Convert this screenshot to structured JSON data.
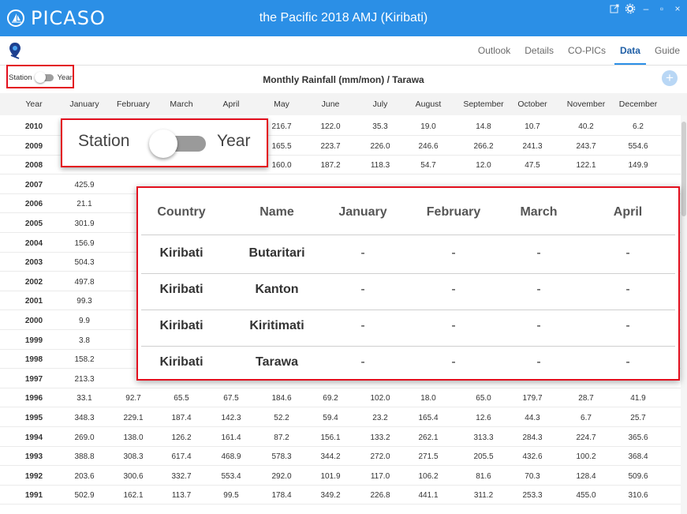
{
  "app": {
    "logo_text": "PICASO",
    "window_title": "the Pacific 2018 AMJ (Kiribati)",
    "controls": {
      "minimize": "–",
      "maximize": "▫",
      "close": "×"
    }
  },
  "toolbar": {
    "tabs": [
      {
        "label": "Outlook",
        "active": false
      },
      {
        "label": "Details",
        "active": false
      },
      {
        "label": "CO-PICs",
        "active": false
      },
      {
        "label": "Data",
        "active": true
      },
      {
        "label": "Guide",
        "active": false
      }
    ]
  },
  "subheader": {
    "toggle_left": "Station",
    "toggle_right": "Year",
    "table_title": "Monthly Rainfall (mm/mon) / Tarawa",
    "add_label": "+"
  },
  "table": {
    "columns": [
      "Year",
      "January",
      "February",
      "March",
      "April",
      "May",
      "June",
      "July",
      "August",
      "September",
      "October",
      "November",
      "December"
    ],
    "rows": [
      [
        "2010",
        "",
        "",
        "",
        "",
        "216.7",
        "122.0",
        "35.3",
        "19.0",
        "14.8",
        "10.7",
        "40.2",
        "6.2"
      ],
      [
        "2009",
        "",
        "",
        "",
        "",
        "165.5",
        "223.7",
        "226.0",
        "246.6",
        "266.2",
        "241.3",
        "243.7",
        "554.6"
      ],
      [
        "2008",
        "",
        "",
        "",
        "",
        "160.0",
        "187.2",
        "118.3",
        "54.7",
        "12.0",
        "47.5",
        "122.1",
        "149.9"
      ],
      [
        "2007",
        "425.9",
        "",
        "",
        "",
        "",
        "",
        "",
        "",
        "",
        "",
        "",
        ""
      ],
      [
        "2006",
        "21.1",
        "",
        "",
        "",
        "",
        "",
        "",
        "",
        "",
        "",
        "",
        ""
      ],
      [
        "2005",
        "301.9",
        "",
        "",
        "",
        "",
        "",
        "",
        "",
        "",
        "",
        "",
        ""
      ],
      [
        "2004",
        "156.9",
        "",
        "",
        "",
        "",
        "",
        "",
        "",
        "",
        "",
        "",
        ""
      ],
      [
        "2003",
        "504.3",
        "",
        "",
        "",
        "",
        "",
        "",
        "",
        "",
        "",
        "",
        ""
      ],
      [
        "2002",
        "497.8",
        "",
        "",
        "",
        "",
        "",
        "",
        "",
        "",
        "",
        "",
        ""
      ],
      [
        "2001",
        "99.3",
        "",
        "",
        "",
        "",
        "",
        "",
        "",
        "",
        "",
        "",
        ""
      ],
      [
        "2000",
        "9.9",
        "",
        "",
        "",
        "",
        "",
        "",
        "",
        "",
        "",
        "",
        ""
      ],
      [
        "1999",
        "3.8",
        "",
        "",
        "",
        "",
        "",
        "",
        "",
        "",
        "",
        "",
        ""
      ],
      [
        "1998",
        "158.2",
        "",
        "",
        "",
        "",
        "",
        "",
        "",
        "",
        "",
        "",
        ""
      ],
      [
        "1997",
        "213.3",
        "",
        "",
        "",
        "",
        "",
        "",
        "",
        "",
        "",
        "",
        ""
      ],
      [
        "1996",
        "33.1",
        "92.7",
        "65.5",
        "67.5",
        "184.6",
        "69.2",
        "102.0",
        "18.0",
        "65.0",
        "179.7",
        "28.7",
        "41.9"
      ],
      [
        "1995",
        "348.3",
        "229.1",
        "187.4",
        "142.3",
        "52.2",
        "59.4",
        "23.2",
        "165.4",
        "12.6",
        "44.3",
        "6.7",
        "25.7"
      ],
      [
        "1994",
        "269.0",
        "138.0",
        "126.2",
        "161.4",
        "87.2",
        "156.1",
        "133.2",
        "262.1",
        "313.3",
        "284.3",
        "224.7",
        "365.6"
      ],
      [
        "1993",
        "388.8",
        "308.3",
        "617.4",
        "468.9",
        "578.3",
        "344.2",
        "272.0",
        "271.5",
        "205.5",
        "432.6",
        "100.2",
        "368.4"
      ],
      [
        "1992",
        "203.6",
        "300.6",
        "332.7",
        "553.4",
        "292.0",
        "101.9",
        "117.0",
        "106.2",
        "81.6",
        "70.3",
        "128.4",
        "509.6"
      ],
      [
        "1991",
        "502.9",
        "162.1",
        "113.7",
        "99.5",
        "178.4",
        "349.2",
        "226.8",
        "441.1",
        "311.2",
        "253.3",
        "455.0",
        "310.6"
      ]
    ]
  },
  "zoom_toggle": {
    "left": "Station",
    "right": "Year"
  },
  "popup": {
    "columns": [
      "Country",
      "Name",
      "January",
      "February",
      "March",
      "April"
    ],
    "rows": [
      [
        "Kiribati",
        "Butaritari",
        "-",
        "-",
        "-",
        "-"
      ],
      [
        "Kiribati",
        "Kanton",
        "-",
        "-",
        "-",
        "-"
      ],
      [
        "Kiribati",
        "Kiritimati",
        "-",
        "-",
        "-",
        "-"
      ],
      [
        "Kiribati",
        "Tarawa",
        "-",
        "-",
        "-",
        "-"
      ]
    ]
  }
}
